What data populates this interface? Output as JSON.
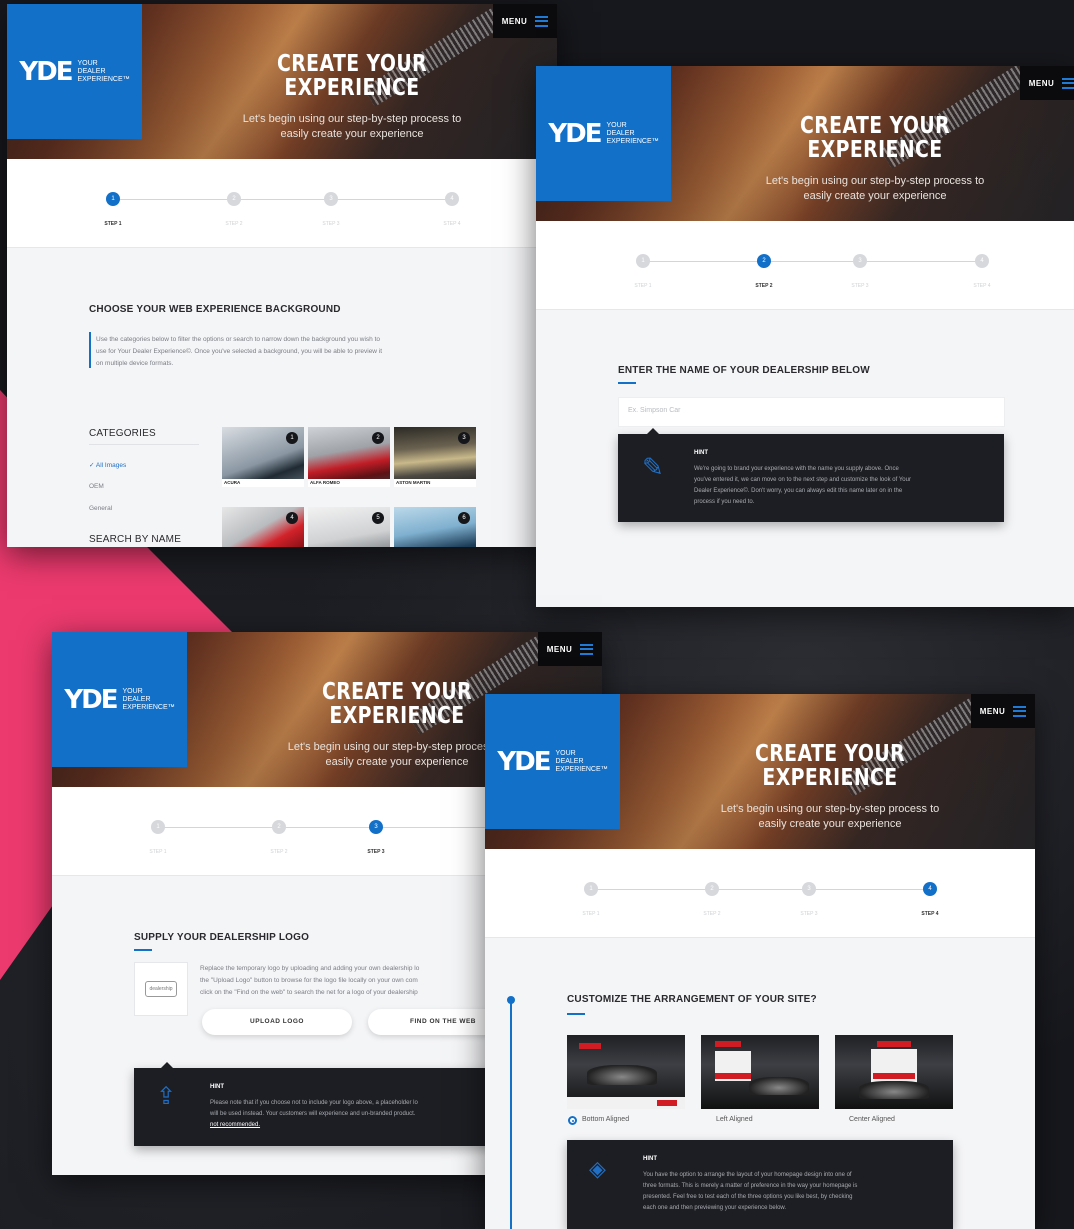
{
  "brand": {
    "logo_mark": "YDE",
    "logo_line1": "YOUR",
    "logo_line2": "DEALER",
    "logo_line3": "EXPERIENCE™",
    "accent": "#1370c9",
    "pink": "#ec3a6e"
  },
  "header": {
    "menu_label": "MENU",
    "title_line1": "CREATE YOUR",
    "title_line2": "EXPERIENCE",
    "subtitle_line1": "Let's begin using our step-by-step process to",
    "subtitle_line2": "easily create your experience"
  },
  "steps": [
    "STEP 1",
    "STEP 2",
    "STEP 3",
    "STEP 4"
  ],
  "screen1": {
    "section_title": "CHOOSE YOUR WEB EXPERIENCE BACKGROUND",
    "intro_line1": "Use the categories below to filter the options or search to narrow down the background you wish to",
    "intro_line2": "use for Your Dealer Experience©. Once you've selected a background, you will be able to preview it",
    "intro_line3": "on multiple device formats.",
    "categories_title": "CATEGORIES",
    "categories": [
      "All Images",
      "OEM",
      "General"
    ],
    "search_title": "SEARCH BY NAME",
    "thumbs": [
      {
        "caption": "ACURA",
        "badge": "1"
      },
      {
        "caption": "ALFA ROMEO",
        "badge": "2"
      },
      {
        "caption": "ASTON MARTIN",
        "badge": "3"
      },
      {
        "caption": "",
        "badge": "4"
      },
      {
        "caption": "",
        "badge": "5"
      },
      {
        "caption": "",
        "badge": "6"
      }
    ]
  },
  "screen2": {
    "section_title": "ENTER THE NAME OF YOUR DEALERSHIP BELOW",
    "input_placeholder": "Ex. Simpson Car",
    "hint_title": "HINT",
    "hint_line1": "We're going to brand your experience with the name you supply above. Once",
    "hint_line2": "you've entered it, we can move on to the next step and customize the look of Your",
    "hint_line3": "Dealer Experience©. Don't worry, you can always edit this name later on in the",
    "hint_line4": "process if you need to."
  },
  "screen3": {
    "section_title": "SUPPLY YOUR DEALERSHIP LOGO",
    "logo_placeholder": "dealership",
    "text_line1": "Replace the temporary logo by uploading and adding your own dealership lo",
    "text_line2": "the \"Upload Logo\" button to browse for the logo file locally on your own com",
    "text_line3": "click on the \"Find on the web\" to search the net for a logo of your dealership",
    "upload_button": "UPLOAD LOGO",
    "find_button": "FIND ON THE WEB",
    "hint_title": "HINT",
    "hint_line1": "Please note that if you choose not to include your logo above, a placeholder lo",
    "hint_line2": "will be used instead. Your customers will experience and un-branded product.",
    "hint_line3": "not recommended."
  },
  "screen4": {
    "section_title": "CUSTOMIZE THE ARRANGEMENT OF YOUR SITE?",
    "options": [
      "Bottom Aligned",
      "Left Aligned",
      "Center Aligned"
    ],
    "selected_option": "Bottom Aligned",
    "hint_title": "HINT",
    "hint_line1": "You have the option to arrange the layout of your homepage design into one of",
    "hint_line2": "three formats. This is merely a matter of preference in the way your homepage is",
    "hint_line3": "presented. Feel free to test each of the three options you like best, by checking",
    "hint_line4": "each one and then previewing your experience below."
  }
}
